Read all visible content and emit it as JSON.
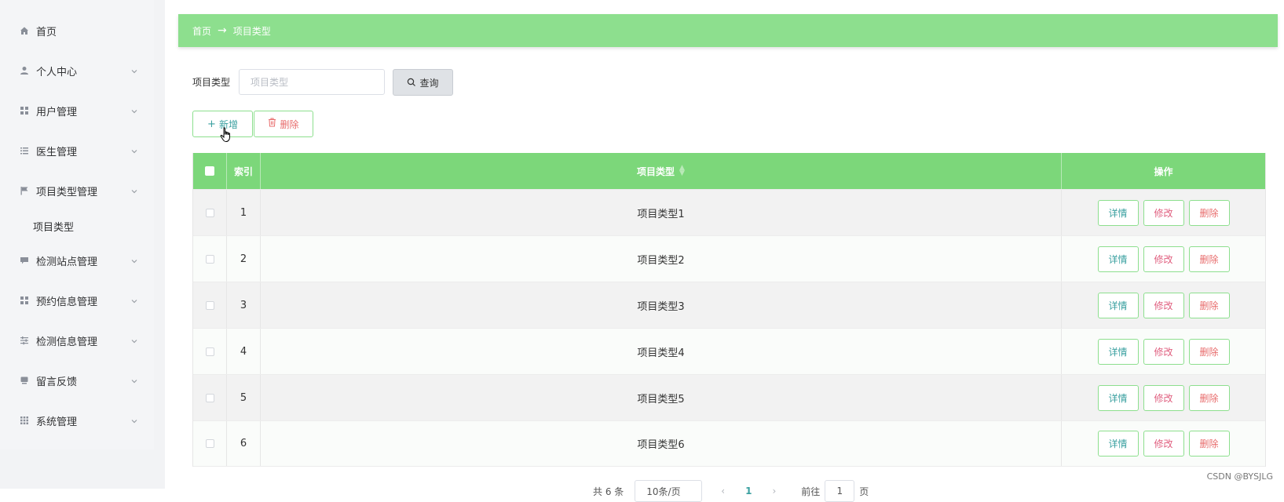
{
  "sidebar": {
    "items": [
      {
        "label": "首页",
        "icon": "home-icon"
      },
      {
        "label": "个人中心",
        "icon": "user-icon"
      },
      {
        "label": "用户管理",
        "icon": "grid-icon"
      },
      {
        "label": "医生管理",
        "icon": "list-icon"
      },
      {
        "label": "项目类型管理",
        "icon": "flag-icon"
      },
      {
        "label": "检测站点管理",
        "icon": "chat-icon"
      },
      {
        "label": "预约信息管理",
        "icon": "grid-icon"
      },
      {
        "label": "检测信息管理",
        "icon": "sliders-icon"
      },
      {
        "label": "留言反馈",
        "icon": "message-icon"
      },
      {
        "label": "系统管理",
        "icon": "apps-icon"
      }
    ],
    "subitem": "项目类型"
  },
  "breadcrumb": {
    "home": "首页",
    "separator": "→",
    "current": "项目类型"
  },
  "search": {
    "label": "项目类型",
    "placeholder": "项目类型",
    "value": "",
    "button": "查询"
  },
  "actions": {
    "add": "新增",
    "delete": "删除"
  },
  "table": {
    "headers": {
      "index": "索引",
      "name": "项目类型",
      "ops": "操作"
    },
    "rows": [
      {
        "index": "1",
        "name": "项目类型1"
      },
      {
        "index": "2",
        "name": "项目类型2"
      },
      {
        "index": "3",
        "name": "项目类型3"
      },
      {
        "index": "4",
        "name": "项目类型4"
      },
      {
        "index": "5",
        "name": "项目类型5"
      },
      {
        "index": "6",
        "name": "项目类型6"
      }
    ],
    "row_buttons": {
      "detail": "详情",
      "edit": "修改",
      "delete": "删除"
    }
  },
  "pagination": {
    "total": "共 6 条",
    "page_size": "10条/页",
    "prev": "‹",
    "current_page": "1",
    "next": "›",
    "goto": "前往",
    "jump_value": "1",
    "unit": "页"
  },
  "watermark": "CSDN @BYSJLG",
  "colors": {
    "accent": "#8ddf8e",
    "header": "#7cd77a",
    "detail": "#3aa0a0",
    "edit": "#e06080",
    "delete": "#e86c6c"
  }
}
